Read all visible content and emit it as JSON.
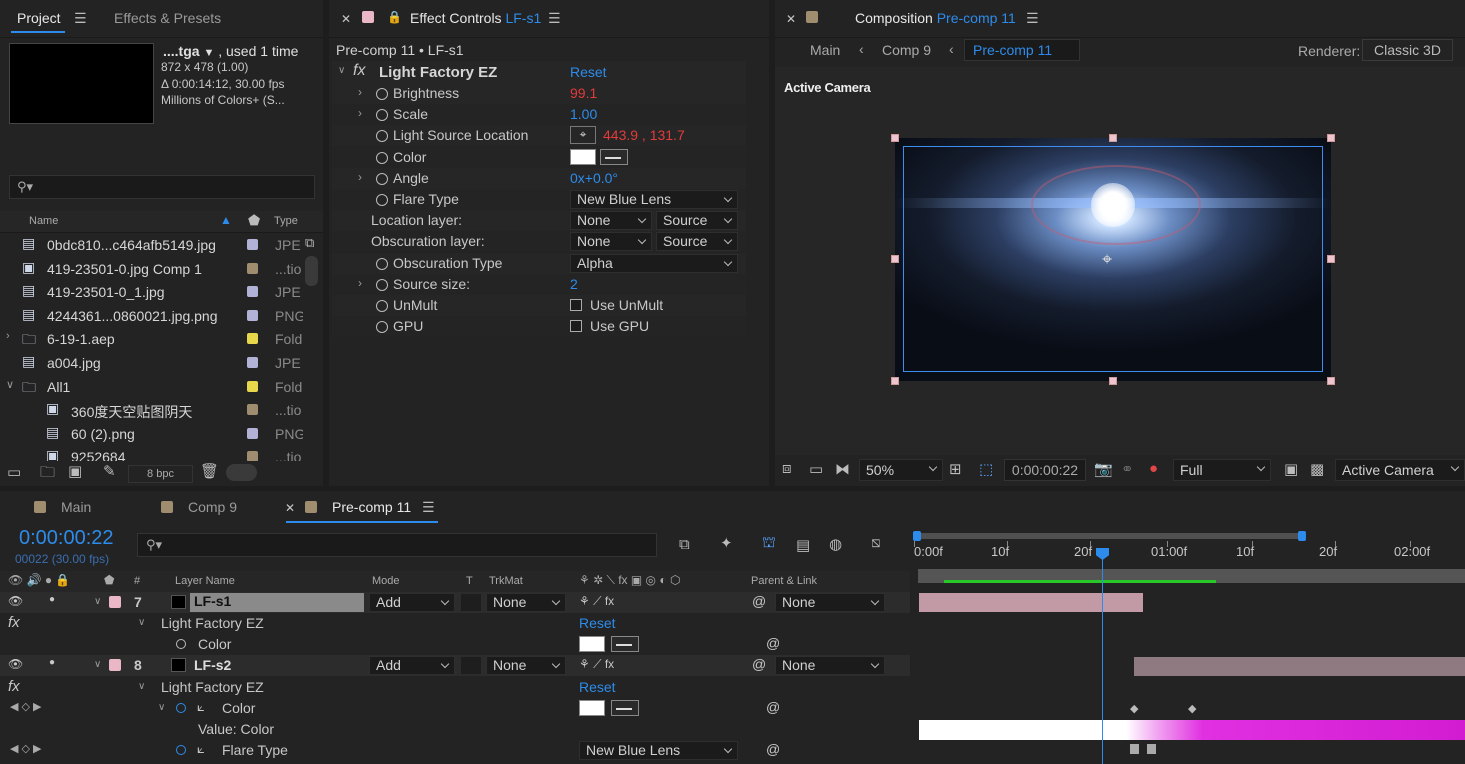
{
  "project": {
    "tabs": [
      {
        "label": "Project"
      },
      {
        "label": "Effects & Presets"
      }
    ],
    "file": {
      "name": "....tga",
      "used": ", used 1 time",
      "dims": "872 x 478 (1.00)",
      "duration": "Δ 0:00:14:12, 30.00 fps",
      "colors": "Millions of Colors+ (S..."
    },
    "search_placeholder": "",
    "columns": {
      "name": "Name",
      "type": "Type"
    },
    "items": [
      {
        "name": "0bdc810...c464afb5149.jpg",
        "type": "JPE",
        "color": "#b2b2d6"
      },
      {
        "name": "419-23501-0.jpg Comp 1",
        "type": "...tio",
        "color": "#a08c6e"
      },
      {
        "name": "419-23501-0_1.jpg",
        "type": "JPE",
        "color": "#b2b2d6"
      },
      {
        "name": "4244361...0860021.jpg.png",
        "type": "PNG",
        "color": "#b2b2d6"
      },
      {
        "name": "6-19-1.aep",
        "type": "Fold",
        "color": "#e6d84a"
      },
      {
        "name": "a004.jpg",
        "type": "JPE",
        "color": "#b2b2d6"
      },
      {
        "name": "All1",
        "type": "Fold",
        "color": "#e6d84a"
      },
      {
        "name": "360度天空贴图阴天",
        "type": "...tio",
        "color": "#a08c6e"
      },
      {
        "name": "60 (2).png",
        "type": "PNG",
        "color": "#b2b2d6"
      },
      {
        "name": "9252684",
        "type": "...tio",
        "color": "#a08c6e"
      }
    ],
    "bpc": "8 bpc"
  },
  "effects": {
    "tab_label": "Effect Controls",
    "tab_layer": "LF-s1",
    "breadcrumb": "Pre-comp 11 • LF-s1",
    "effect_name": "Light Factory EZ",
    "reset": "Reset",
    "props": [
      {
        "label": "Brightness",
        "value": "99.1"
      },
      {
        "label": "Scale",
        "value": "1.00"
      },
      {
        "label": "Light Source Location",
        "value": "443.9 , 131.7"
      },
      {
        "label": "Color",
        "value": ""
      },
      {
        "label": "Angle",
        "value": "0x+0.0°"
      },
      {
        "label": "Flare Type",
        "value": "New Blue Lens"
      },
      {
        "label": "Location layer:",
        "value": "None",
        "value2": "Source"
      },
      {
        "label": "Obscuration layer:",
        "value": "None",
        "value2": "Source"
      },
      {
        "label": "Obscuration Type",
        "value": "Alpha"
      },
      {
        "label": "Source size:",
        "value": "2"
      },
      {
        "label": "UnMult",
        "value": "Use UnMult"
      },
      {
        "label": "GPU",
        "value": "Use GPU"
      }
    ]
  },
  "composition": {
    "tab_label": "Composition",
    "tab_comp": "Pre-comp 11",
    "crumbs": [
      "Main",
      "Comp 9",
      "Pre-comp 11"
    ],
    "renderer_label": "Renderer:",
    "renderer": "Classic 3D",
    "camera_label": "Active Camera",
    "zoom": "50%",
    "timecode": "0:00:00:22",
    "resolution": "Full",
    "view": "Active Camera"
  },
  "timeline": {
    "tabs": [
      {
        "label": "Main"
      },
      {
        "label": "Comp 9"
      },
      {
        "label": "Pre-comp 11"
      }
    ],
    "timecode": "0:00:00:22",
    "frames": "00022 (30.00 fps)",
    "search_placeholder": "",
    "columns": {
      "num": "#",
      "layer_name": "Layer Name",
      "mode": "Mode",
      "t": "T",
      "trkmat": "TrkMat",
      "parent": "Parent & Link"
    },
    "ruler": [
      "0:00f",
      "10f",
      "20f",
      "01:00f",
      "10f",
      "20f",
      "02:00f"
    ],
    "layers": [
      {
        "num": "7",
        "name": "LF-s1",
        "mode": "Add",
        "trkmat": "None",
        "parent": "None"
      },
      {
        "num": "8",
        "name": "LF-s2",
        "mode": "Add",
        "trkmat": "None",
        "parent": "None"
      }
    ],
    "effect_name": "Light Factory EZ",
    "reset": "Reset",
    "color_label": "Color",
    "value_color": "Value: Color",
    "flare_type_label": "Flare Type",
    "flare_type_value": "New Blue Lens"
  }
}
